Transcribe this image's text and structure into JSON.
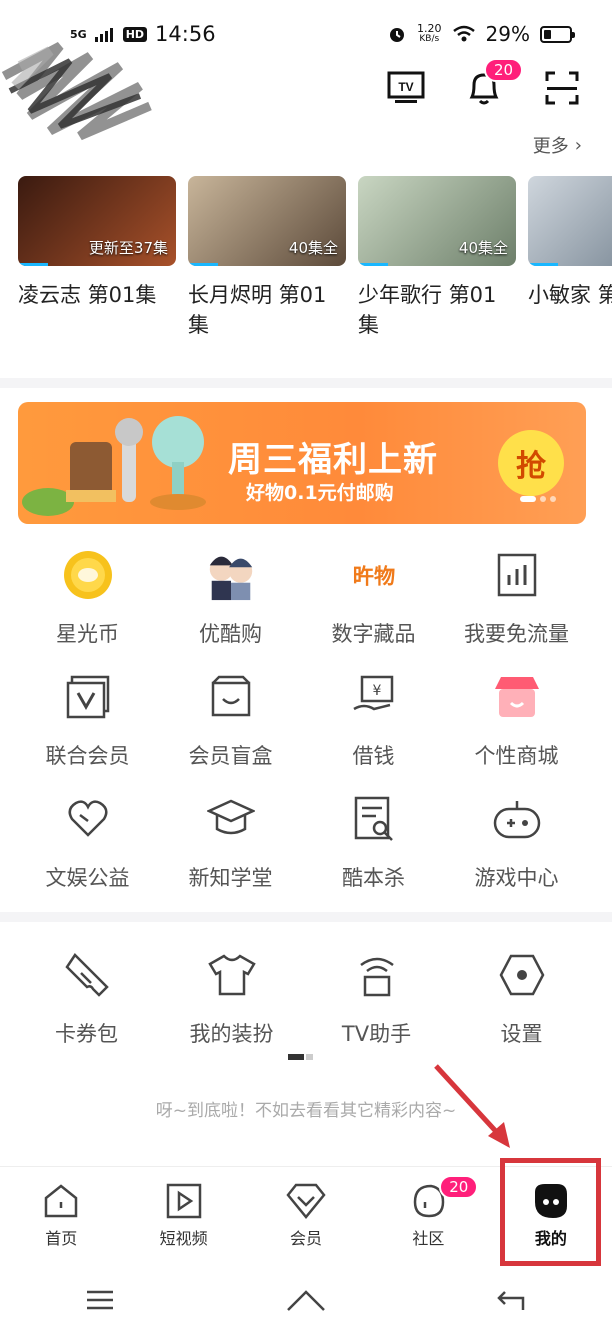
{
  "status": {
    "network": "5G",
    "hd": "HD",
    "time": "14:56",
    "speed_value": "1.20",
    "speed_unit": "KB/s",
    "battery": "29%",
    "battery_level": 0.29
  },
  "header": {
    "tv_icon": "tv-icon",
    "bell_badge": "20",
    "scan_icon": "scan-icon",
    "more_label": "更多"
  },
  "history": [
    {
      "title": "凌云志 第01集",
      "episode": "更新至37集",
      "colors": [
        "#3a1a10",
        "#a8512a"
      ]
    },
    {
      "title": "长月烬明 第01集",
      "episode": "40集全",
      "colors": [
        "#c8b59a",
        "#5c4a3a"
      ]
    },
    {
      "title": "少年歌行 第01集",
      "episode": "40集全",
      "colors": [
        "#c9d6c2",
        "#6d7f6a"
      ]
    },
    {
      "title": "小敏家 第01集",
      "episode": "",
      "colors": [
        "#cfd6dd",
        "#6b7a88"
      ]
    }
  ],
  "banner": {
    "headline": "周三福利上新",
    "subline": "好物0.1元付邮购",
    "button": "抢"
  },
  "services": [
    {
      "label": "星光币",
      "icon": "coin-icon"
    },
    {
      "label": "优酷购",
      "icon": "characters-icon"
    },
    {
      "label": "数字藏品",
      "icon": "collectible-icon"
    },
    {
      "label": "我要免流量",
      "icon": "data-icon"
    },
    {
      "label": "联合会员",
      "icon": "joint-member-icon"
    },
    {
      "label": "会员盲盒",
      "icon": "blind-box-icon"
    },
    {
      "label": "借钱",
      "icon": "borrow-icon"
    },
    {
      "label": "个性商城",
      "icon": "shop-icon"
    },
    {
      "label": "文娱公益",
      "icon": "charity-icon"
    },
    {
      "label": "新知学堂",
      "icon": "graduation-icon"
    },
    {
      "label": "酷本杀",
      "icon": "script-icon"
    },
    {
      "label": "游戏中心",
      "icon": "gamepad-icon"
    }
  ],
  "tools": [
    {
      "label": "卡券包",
      "icon": "ticket-icon"
    },
    {
      "label": "我的装扮",
      "icon": "shirt-icon"
    },
    {
      "label": "TV助手",
      "icon": "tv-assistant-icon"
    },
    {
      "label": "设置",
      "icon": "settings-icon"
    }
  ],
  "footer_note": "呀~到底啦！不如去看看其它精彩内容~",
  "tabs": [
    {
      "label": "首页",
      "icon": "home-icon"
    },
    {
      "label": "短视频",
      "icon": "short-video-icon"
    },
    {
      "label": "会员",
      "icon": "vip-icon"
    },
    {
      "label": "社区",
      "icon": "community-icon",
      "badge": "20"
    },
    {
      "label": "我的",
      "icon": "profile-icon",
      "active": true
    }
  ],
  "colors": {
    "accent_pink": "#ff1f7a",
    "annotation_red": "#d7363c",
    "banner_orange": "#ff8a3a"
  }
}
